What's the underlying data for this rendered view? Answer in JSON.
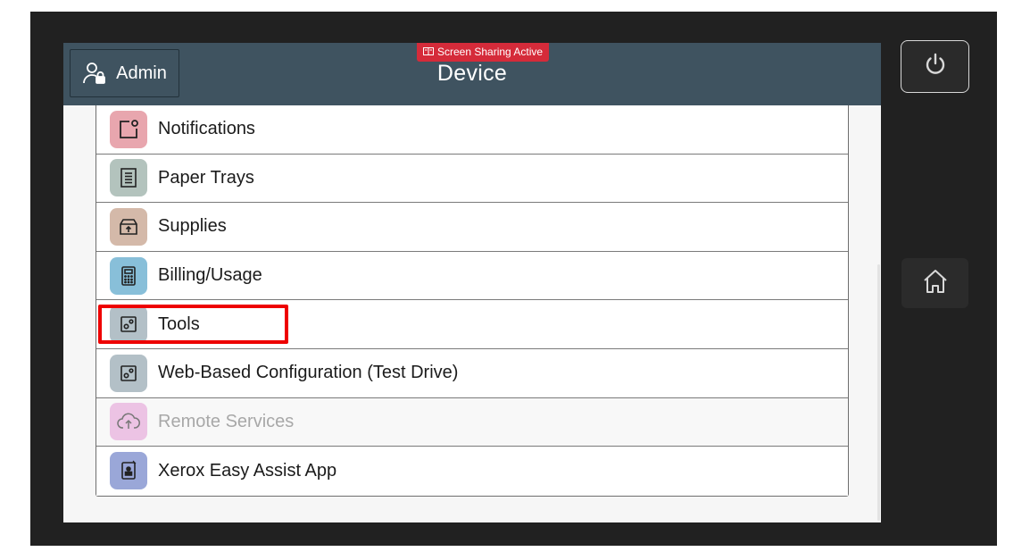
{
  "header": {
    "admin_label": "Admin",
    "title": "Device",
    "badge": "Screen Sharing Active"
  },
  "menu": {
    "items": [
      {
        "label": "Notifications",
        "icon": "notification-icon",
        "color": "#e8a6ae",
        "enabled": true
      },
      {
        "label": "Paper Trays",
        "icon": "paper-tray-icon",
        "color": "#b3c3bd",
        "enabled": true
      },
      {
        "label": "Supplies",
        "icon": "supplies-box-icon",
        "color": "#d4b9a9",
        "enabled": true
      },
      {
        "label": "Billing/Usage",
        "icon": "calculator-icon",
        "color": "#88bfd9",
        "enabled": true
      },
      {
        "label": "Tools",
        "icon": "tools-icon",
        "color": "#b3c0c7",
        "enabled": true
      },
      {
        "label": "Web-Based Configuration (Test Drive)",
        "icon": "tools-icon",
        "color": "#b3c0c7",
        "enabled": true
      },
      {
        "label": "Remote Services",
        "icon": "cloud-upload-icon",
        "color": "#ecc3e4",
        "enabled": false
      },
      {
        "label": "Xerox Easy Assist App",
        "icon": "mobile-app-icon",
        "color": "#9aa7d8",
        "enabled": true
      }
    ]
  },
  "colors": {
    "header_bg": "#3f5360",
    "badge_bg": "#d52b3a",
    "highlight": "#ee0000",
    "frame": "#212121"
  }
}
